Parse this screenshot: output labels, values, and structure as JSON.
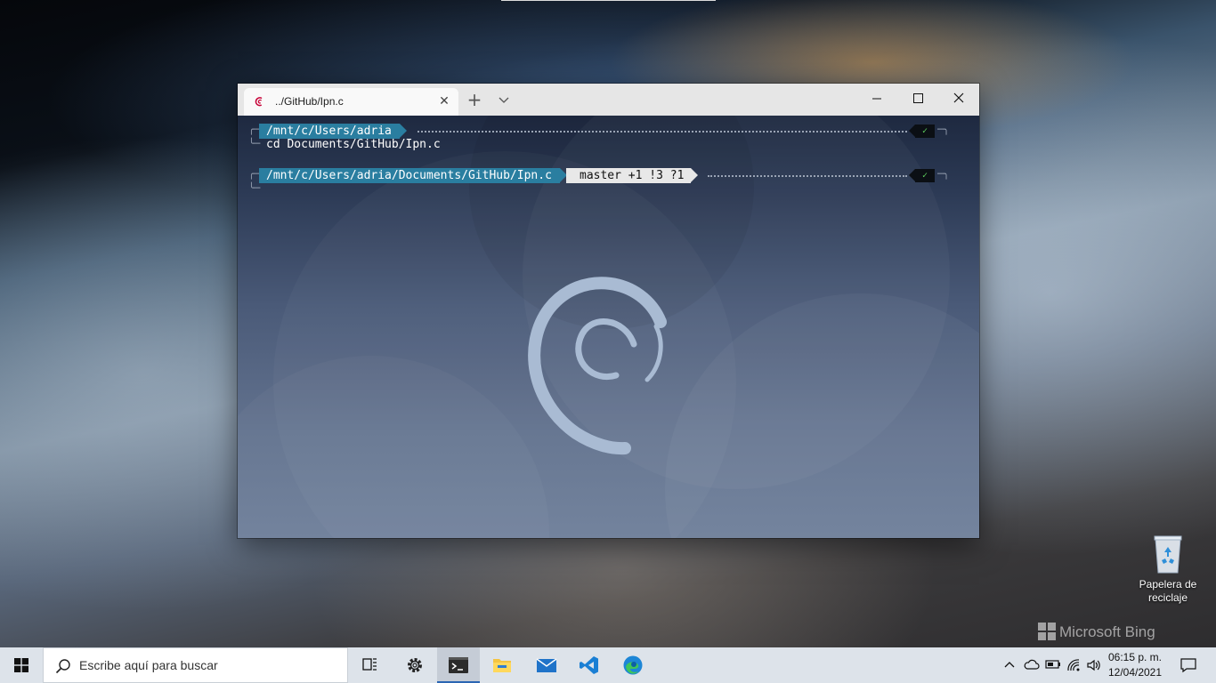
{
  "window": {
    "tab_title": "../GitHub/Ipn.c",
    "close_tab_glyph": "✕",
    "new_tab_glyph": "+",
    "dropdown_glyph": "⌄",
    "minimize_glyph": "—",
    "maximize_glyph": "☐",
    "close_glyph": "✕"
  },
  "terminal": {
    "prompt1_path": "/mnt/c/Users/adria",
    "command1": "cd Documents/GitHub/Ipn.c",
    "prompt2_path": "/mnt/c/Users/adria/Documents/GitHub/Ipn.c",
    "prompt2_git": "master +1 !3 ?1",
    "status_glyph": "✓",
    "status_color": "#5fd35f",
    "path_segment_color": "#2a7ea0"
  },
  "desktop": {
    "recycle_bin_label_line1": "Papelera de",
    "recycle_bin_label_line2": "reciclaje",
    "watermark": "Microsoft Bing"
  },
  "taskbar": {
    "search_placeholder": "Escribe aquí para buscar",
    "apps": [
      "task-view",
      "settings",
      "terminal",
      "file-explorer",
      "mail",
      "vscode",
      "edge"
    ],
    "active_app": "terminal",
    "time": "06:15 p. m.",
    "date": "12/04/2021"
  }
}
